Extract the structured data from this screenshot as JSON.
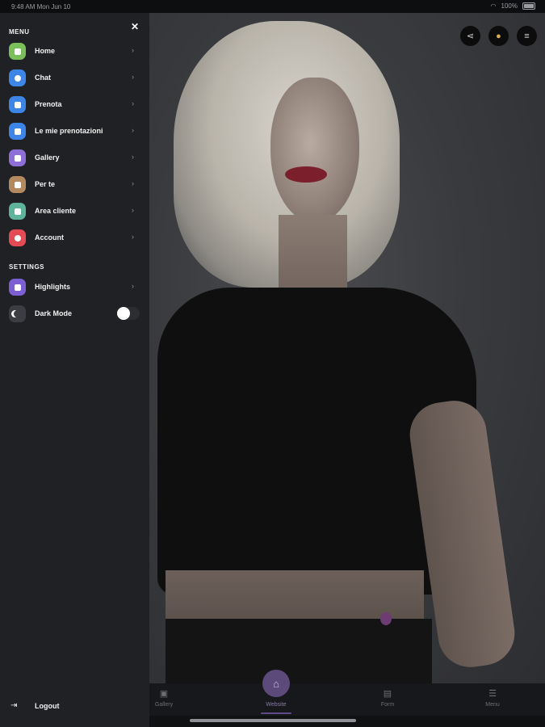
{
  "status_bar": {
    "time": "9:48 AM  Mon Jun 10",
    "battery": "100%"
  },
  "drawer": {
    "menu_title": "MENU",
    "settings_title": "SETTINGS",
    "menu_items": [
      {
        "label": "Home",
        "icon": "home-icon",
        "color": "#7bbf5a"
      },
      {
        "label": "Chat",
        "icon": "chat-icon",
        "color": "#3d86e8"
      },
      {
        "label": "Prenota",
        "icon": "calendar-icon",
        "color": "#3d86e8"
      },
      {
        "label": "Le mie prenotazioni",
        "icon": "list-icon",
        "color": "#3d86e8"
      },
      {
        "label": "Gallery",
        "icon": "camera-icon",
        "color": "#8d6fd7"
      },
      {
        "label": "Per te",
        "icon": "document-icon",
        "color": "#b38a5f"
      },
      {
        "label": "Area cliente",
        "icon": "id-card-icon",
        "color": "#5fb39a"
      },
      {
        "label": "Account",
        "icon": "user-icon",
        "color": "#e54b54"
      }
    ],
    "settings_items": [
      {
        "label": "Highlights",
        "icon": "highlights-icon",
        "color": "#7c5fd2"
      },
      {
        "label": "Dark Mode",
        "icon": "moon-icon",
        "color": "#3b3d42"
      }
    ],
    "logout_label": "Logout"
  },
  "bottom_nav": {
    "items": [
      {
        "label": "Gallery",
        "icon": "gallery-icon"
      },
      {
        "label": "Website",
        "icon": "home-icon"
      },
      {
        "label": "Form",
        "icon": "form-icon"
      },
      {
        "label": "Menu",
        "icon": "menu-icon"
      }
    ]
  }
}
